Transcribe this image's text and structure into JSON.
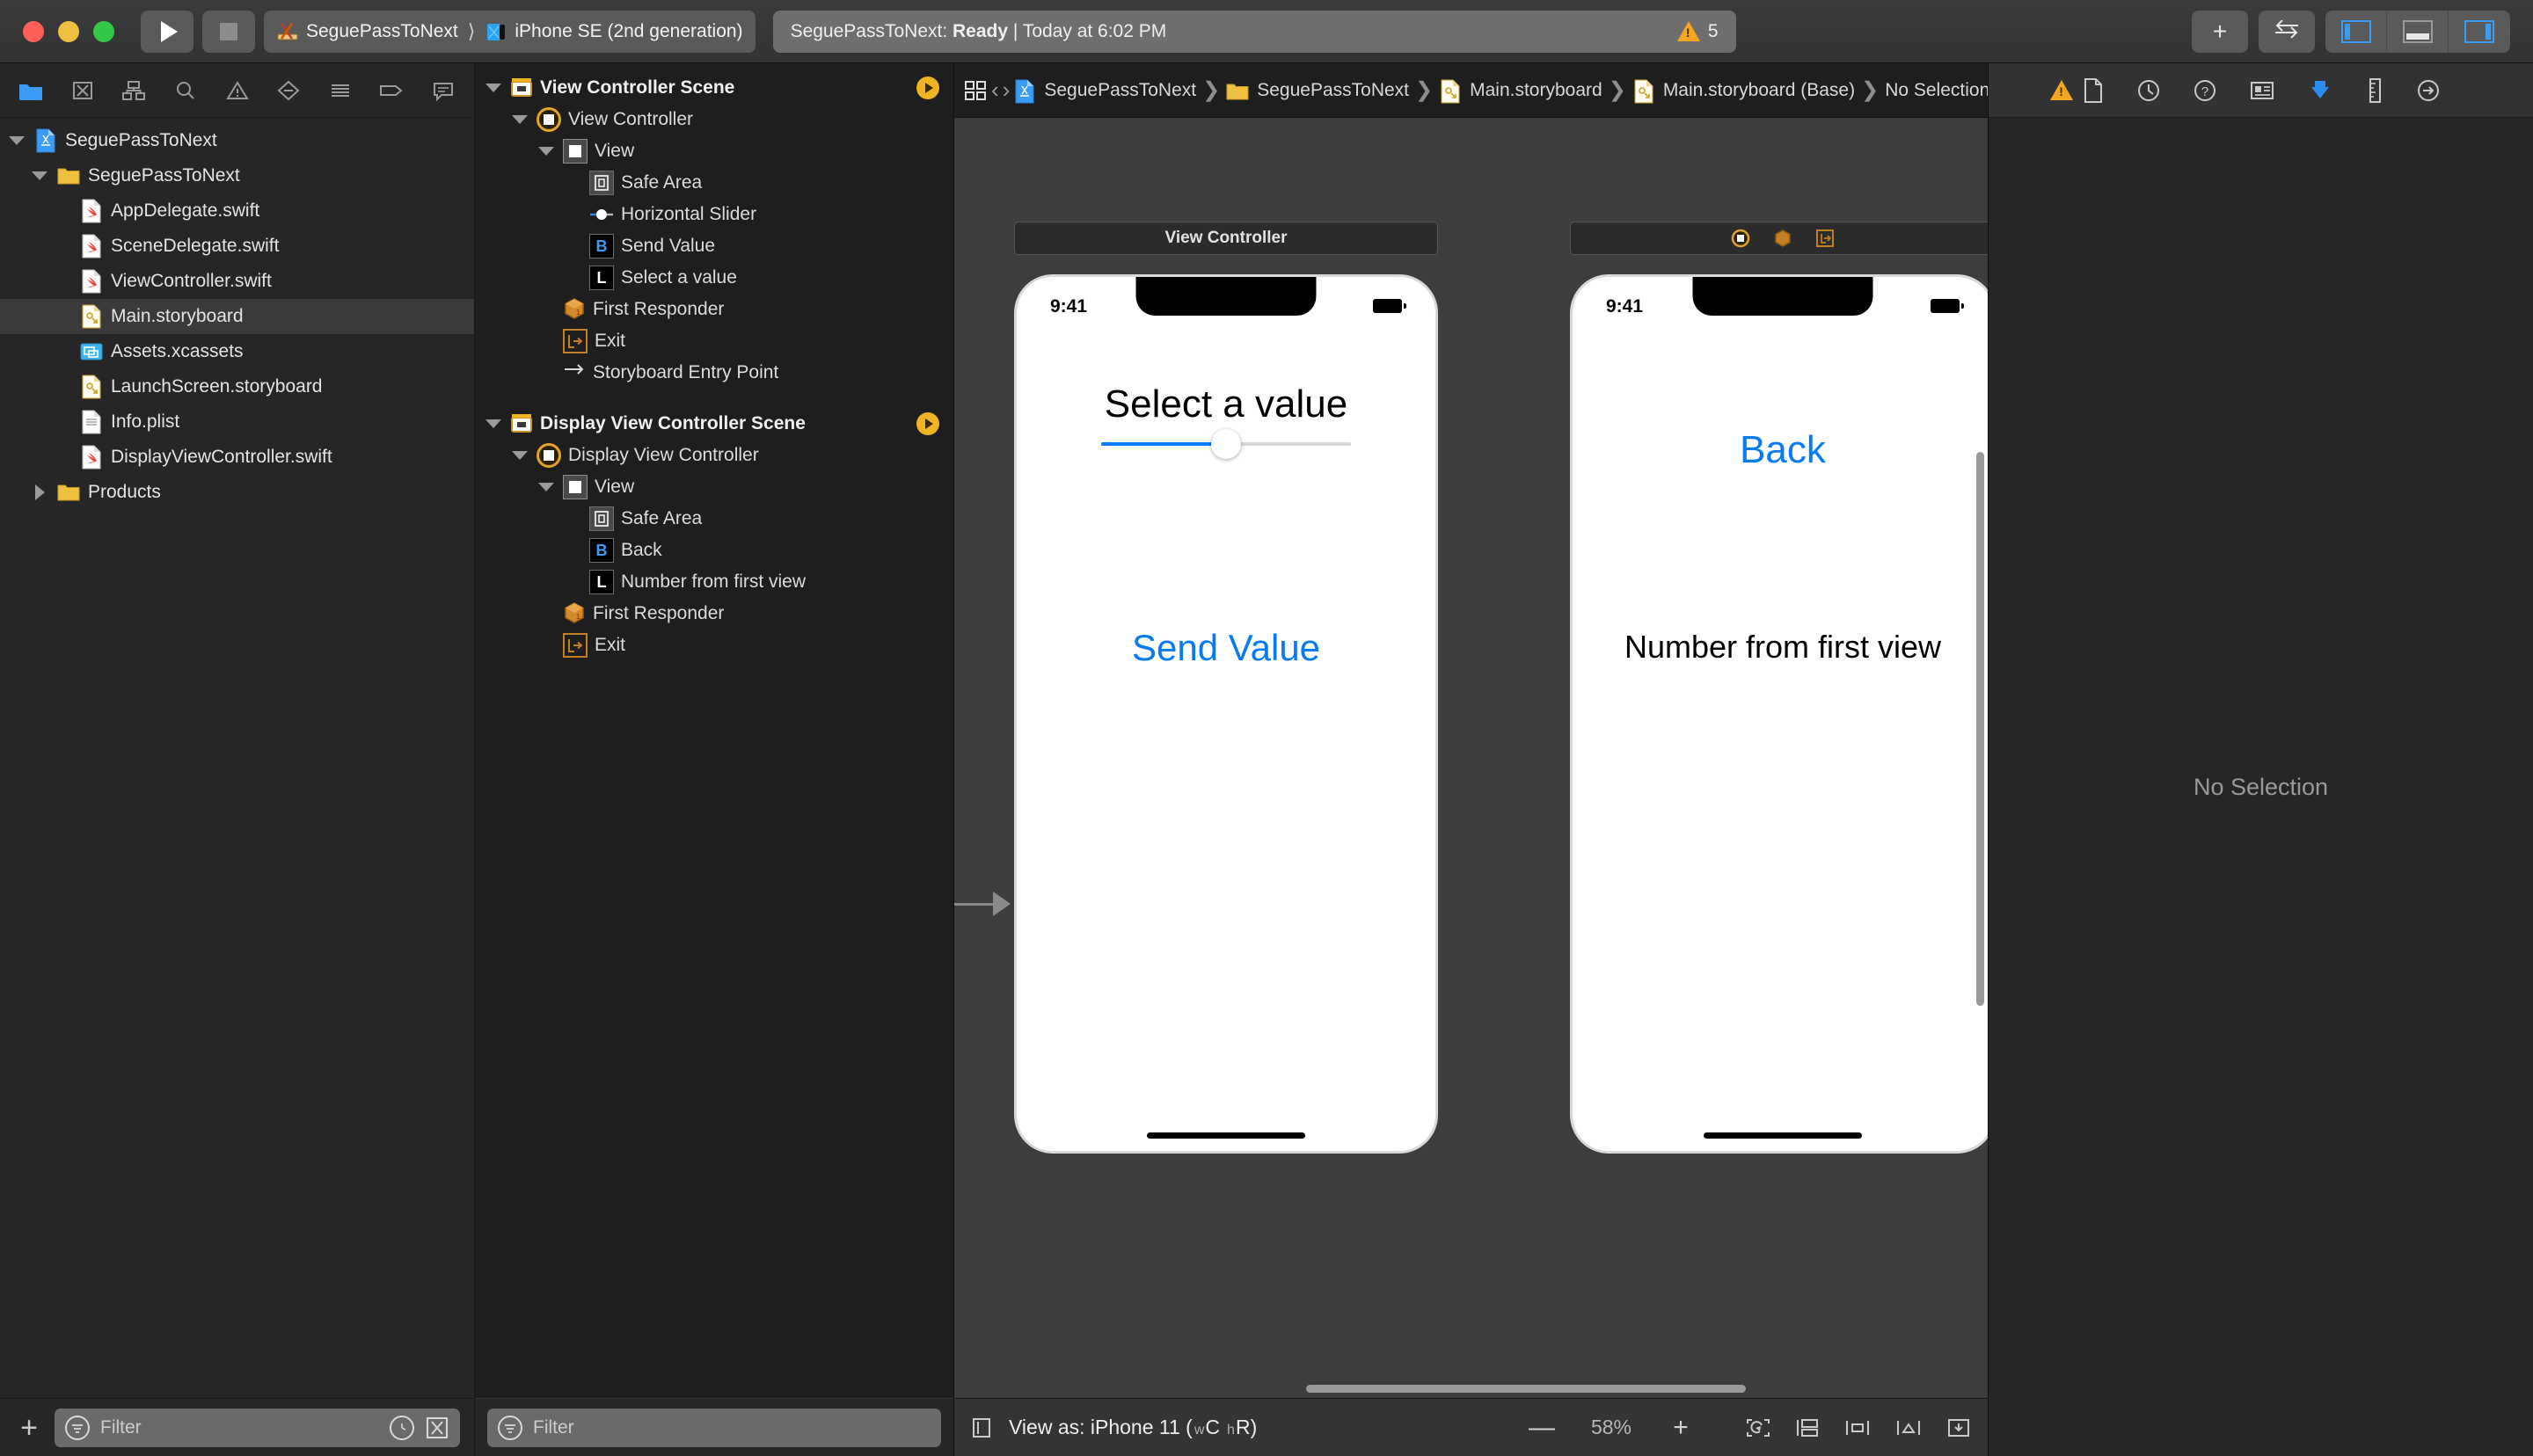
{
  "titlebar": {
    "run_label": "Run",
    "stop_label": "Stop",
    "scheme_name": "SeguePassToNext",
    "destination_name": "iPhone SE (2nd generation)",
    "status_prefix": "SeguePassToNext:",
    "status_state": "Ready",
    "status_separator": "|",
    "status_time": "Today at 6:02 PM",
    "warning_count": "5",
    "add_label": "+",
    "right_buttons": [
      "add-button",
      "code-review-button",
      "navigator-toggle",
      "debug-toggle",
      "inspector-toggle"
    ]
  },
  "navigator": {
    "toolbar_icons": [
      "project-navigator-icon",
      "source-control-icon",
      "symbol-navigator-icon",
      "find-navigator-icon",
      "issue-navigator-icon",
      "test-navigator-icon",
      "debug-navigator-icon",
      "breakpoint-navigator-icon",
      "report-navigator-icon"
    ],
    "tree": [
      {
        "label": "SeguePassToNext",
        "depth": 0,
        "icon": "xcode-project-icon",
        "disclosure": "open",
        "selected": false
      },
      {
        "label": "SeguePassToNext",
        "depth": 1,
        "icon": "folder-icon",
        "disclosure": "open",
        "selected": false
      },
      {
        "label": "AppDelegate.swift",
        "depth": 2,
        "icon": "swift-file-icon",
        "disclosure": "none",
        "selected": false
      },
      {
        "label": "SceneDelegate.swift",
        "depth": 2,
        "icon": "swift-file-icon",
        "disclosure": "none",
        "selected": false
      },
      {
        "label": "ViewController.swift",
        "depth": 2,
        "icon": "swift-file-icon",
        "disclosure": "none",
        "selected": false
      },
      {
        "label": "Main.storyboard",
        "depth": 2,
        "icon": "storyboard-file-icon",
        "disclosure": "none",
        "selected": true
      },
      {
        "label": "Assets.xcassets",
        "depth": 2,
        "icon": "assets-catalog-icon",
        "disclosure": "none",
        "selected": false
      },
      {
        "label": "LaunchScreen.storyboard",
        "depth": 2,
        "icon": "storyboard-file-icon",
        "disclosure": "none",
        "selected": false
      },
      {
        "label": "Info.plist",
        "depth": 2,
        "icon": "plist-file-icon",
        "disclosure": "none",
        "selected": false
      },
      {
        "label": "DisplayViewController.swift",
        "depth": 2,
        "icon": "swift-file-icon",
        "disclosure": "none",
        "selected": false
      },
      {
        "label": "Products",
        "depth": 1,
        "icon": "folder-icon",
        "disclosure": "closed",
        "selected": false
      }
    ],
    "filter_placeholder": "Filter"
  },
  "outline": {
    "rows": [
      {
        "label": "View Controller Scene",
        "depth": 0,
        "icon": "scene-icon",
        "disclosure": "open",
        "bold": true,
        "badge": "scene-arrow"
      },
      {
        "label": "View Controller",
        "depth": 1,
        "icon": "view-controller-icon",
        "disclosure": "open",
        "bold": false,
        "badge": ""
      },
      {
        "label": "View",
        "depth": 2,
        "icon": "view-icon",
        "disclosure": "open",
        "bold": false,
        "badge": ""
      },
      {
        "label": "Safe Area",
        "depth": 3,
        "icon": "safe-area-icon",
        "disclosure": "none",
        "bold": false,
        "badge": ""
      },
      {
        "label": "Horizontal Slider",
        "depth": 3,
        "icon": "slider-icon",
        "disclosure": "none",
        "bold": false,
        "badge": ""
      },
      {
        "label": "Send Value",
        "depth": 3,
        "icon": "button-icon",
        "disclosure": "none",
        "bold": false,
        "badge": ""
      },
      {
        "label": "Select a value",
        "depth": 3,
        "icon": "label-icon",
        "disclosure": "none",
        "bold": false,
        "badge": ""
      },
      {
        "label": "First Responder",
        "depth": 2,
        "icon": "first-responder-icon",
        "disclosure": "none",
        "bold": false,
        "badge": ""
      },
      {
        "label": "Exit",
        "depth": 2,
        "icon": "exit-icon",
        "disclosure": "none",
        "bold": false,
        "badge": ""
      },
      {
        "label": "Storyboard Entry Point",
        "depth": 2,
        "icon": "entry-point-icon",
        "disclosure": "none",
        "bold": false,
        "badge": ""
      },
      {
        "label": "Display View Controller Scene",
        "depth": 0,
        "icon": "scene-icon",
        "disclosure": "open",
        "bold": true,
        "badge": "scene-arrow"
      },
      {
        "label": "Display View Controller",
        "depth": 1,
        "icon": "view-controller-icon",
        "disclosure": "open",
        "bold": false,
        "badge": ""
      },
      {
        "label": "View",
        "depth": 2,
        "icon": "view-icon",
        "disclosure": "open",
        "bold": false,
        "badge": ""
      },
      {
        "label": "Safe Area",
        "depth": 3,
        "icon": "safe-area-icon",
        "disclosure": "none",
        "bold": false,
        "badge": ""
      },
      {
        "label": "Back",
        "depth": 3,
        "icon": "button-icon",
        "disclosure": "none",
        "bold": false,
        "badge": ""
      },
      {
        "label": "Number from first view",
        "depth": 3,
        "icon": "label-icon",
        "disclosure": "none",
        "bold": false,
        "badge": ""
      },
      {
        "label": "First Responder",
        "depth": 2,
        "icon": "first-responder-icon",
        "disclosure": "none",
        "bold": false,
        "badge": ""
      },
      {
        "label": "Exit",
        "depth": 2,
        "icon": "exit-icon",
        "disclosure": "none",
        "bold": false,
        "badge": ""
      }
    ],
    "filter_placeholder": "Filter"
  },
  "editor": {
    "breadcrumbs": [
      {
        "label": "SeguePassToNext",
        "icon": "xcode-project-icon"
      },
      {
        "label": "SeguePassToNext",
        "icon": "folder-icon"
      },
      {
        "label": "Main.storyboard",
        "icon": "storyboard-file-icon"
      },
      {
        "label": "Main.storyboard (Base)",
        "icon": "storyboard-file-icon"
      },
      {
        "label": "No Selection",
        "icon": ""
      }
    ],
    "back_arrow": "‹",
    "forward_arrow": "›",
    "issue_prev": "‹",
    "issue_next": "›"
  },
  "canvas": {
    "scene1": {
      "title": "View Controller",
      "status_time": "9:41",
      "label_title": "Select a value",
      "button_label": "Send Value",
      "slider_value_pct": 50,
      "accent_color": "#067bf4"
    },
    "scene2": {
      "title_icons": [
        "view-controller-icon",
        "first-responder-icon",
        "exit-icon"
      ],
      "status_time": "9:41",
      "button_label": "Back",
      "label_text": "Number from first view",
      "accent_color": "#067bf4"
    }
  },
  "canvas_bottom": {
    "view_as_label": "View as: iPhone 11 (",
    "view_as_w": "w",
    "view_as_wclass": "C",
    "view_as_h": "h",
    "view_as_hclass": "R",
    "view_as_close": ")",
    "zoom_out": "—",
    "zoom_level": "58%",
    "zoom_in": "+",
    "tool_icons": [
      "update-frames-icon",
      "embed-in-icon",
      "align-icon",
      "add-constraints-icon",
      "resolve-issues-icon"
    ]
  },
  "inspector": {
    "tabs": [
      "file-inspector-icon",
      "history-inspector-icon",
      "quick-help-icon",
      "identity-inspector-icon",
      "attributes-inspector-icon",
      "size-inspector-icon",
      "connections-inspector-icon"
    ],
    "active_tab": "attributes-inspector-icon",
    "empty_message": "No Selection"
  }
}
